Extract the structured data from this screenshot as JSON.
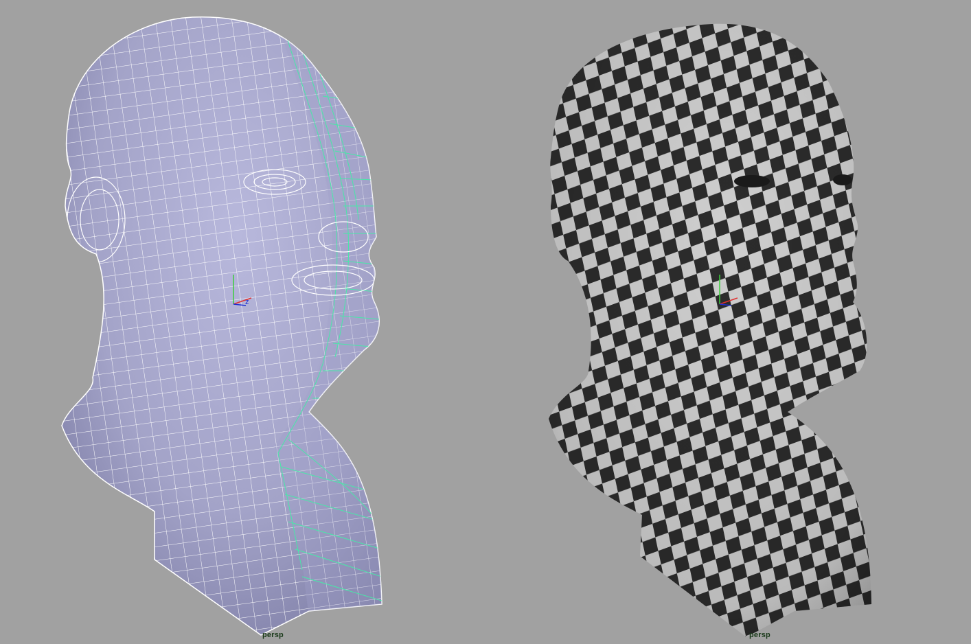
{
  "viewports": [
    {
      "id": "left",
      "camera_label": "persp",
      "display_mode": "smooth-shaded-wireframe-on-shaded",
      "mesh_color": "#a8a8cc",
      "wire_color": "#ffffff",
      "selected_wire_color": "#48e8a8"
    },
    {
      "id": "right",
      "camera_label": "persp",
      "display_mode": "textured-checker",
      "checker_dark": "#2c2c2c",
      "checker_light": "#cfcfcf"
    }
  ],
  "background_color": "#a1a1a1",
  "axis_gizmo": {
    "icon": "axis-gizmo-icon",
    "y_color": "#3ccf3c",
    "x_color": "#e03030",
    "z_color": "#2030d0",
    "z_label": "z"
  }
}
